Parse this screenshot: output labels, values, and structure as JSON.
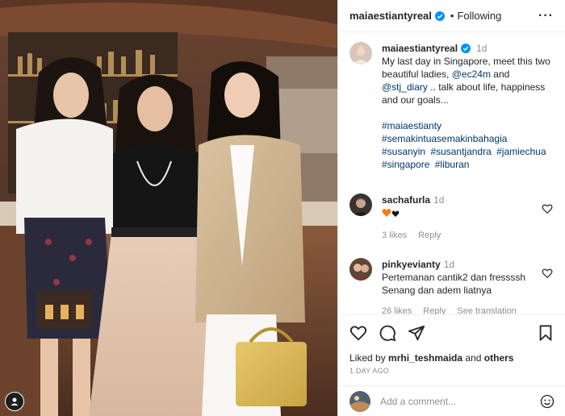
{
  "post": {
    "username": "maiaestiantyreal",
    "follow_status": "Following",
    "separator": "•",
    "caption": {
      "time": "1d",
      "text": "My last day in Singapore, meet this two beautiful ladies, ",
      "mention1": "@ec24m",
      "and_text": " and ",
      "mention2": "@stj_diary",
      "text_end": " .. talk about life, happiness and our goals...",
      "hashtags": [
        "#maiaestianty",
        "#semakintuasemakinbahagia",
        "#susanyin",
        "#susantjandra",
        "#jamiechua",
        "#singapore",
        "#liburan"
      ]
    },
    "comments": [
      {
        "username": "sachafurla",
        "time": "1d",
        "text": "",
        "likes": "3 likes",
        "reply": "Reply"
      },
      {
        "username": "pinkyevianty",
        "time": "1d",
        "text": "Pertemanan cantik2 dan fressssh\nSenang dan adem liatnya",
        "likes": "26 likes",
        "reply": "Reply",
        "see_translation": "See translation"
      }
    ],
    "liked_by_prefix": "Liked by ",
    "liked_by_user": "mrhi_teshmaida",
    "liked_by_suffix": " and ",
    "liked_by_others": "others",
    "date": "1 DAY AGO",
    "comment_placeholder": "Add a comment..."
  },
  "icons": {
    "verified": "verified-badge-icon",
    "more": "more-options-icon",
    "like": "heart-icon",
    "comment": "comment-icon",
    "share": "send-icon",
    "save": "bookmark-icon",
    "emoji": "emoji-icon"
  },
  "colors": {
    "verified_blue": "#0095f6",
    "link": "#00376b",
    "muted": "#8e8e8e",
    "text": "#262626"
  }
}
